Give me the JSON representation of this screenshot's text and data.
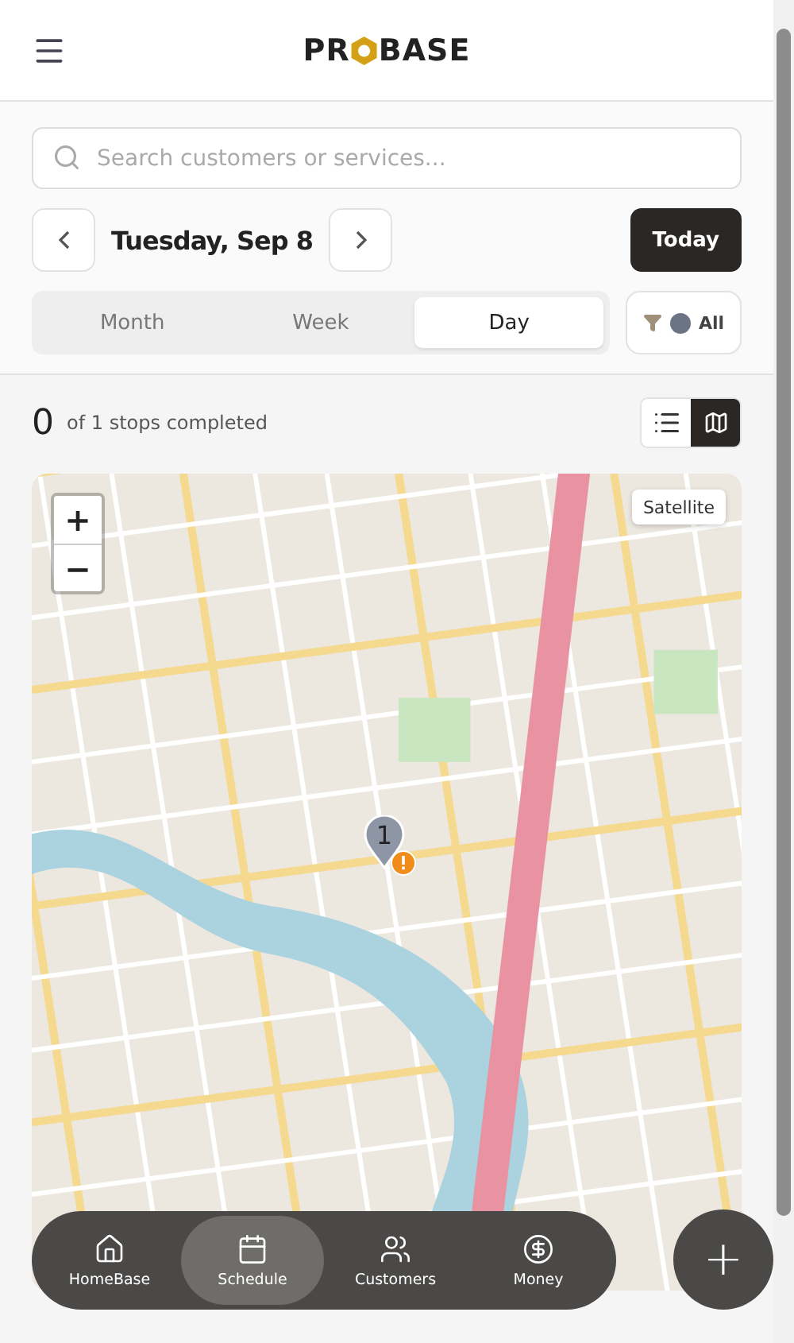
{
  "header": {
    "logo": {
      "before": "PR",
      "after": "BASE"
    }
  },
  "search": {
    "placeholder": "Search customers or services..."
  },
  "date_nav": {
    "date": "Tuesday, Sep 8",
    "today_button": "Today"
  },
  "view_tabs": [
    {
      "label": "Month",
      "selected": false
    },
    {
      "label": "Week",
      "selected": false
    },
    {
      "label": "Day",
      "selected": true
    }
  ],
  "filter": {
    "label": "All",
    "color": "#6b7485"
  },
  "progress": {
    "completed": "0",
    "summary": "of 1 stops completed"
  },
  "view_toggle": [
    {
      "kind": "list",
      "selected": false
    },
    {
      "kind": "map",
      "selected": true
    }
  ],
  "map": {
    "satellite_button": "Satellite",
    "zoom_in": "+",
    "zoom_out": "−",
    "pins": [
      {
        "label": "1",
        "alert": true
      }
    ]
  },
  "bottom_nav": [
    {
      "kind": "home",
      "label": "HomeBase",
      "selected": false
    },
    {
      "kind": "calendar",
      "label": "Schedule",
      "selected": true
    },
    {
      "kind": "people",
      "label": "Customers",
      "selected": false
    },
    {
      "kind": "money",
      "label": "Money",
      "selected": false
    }
  ],
  "fab": {
    "label": "+"
  }
}
